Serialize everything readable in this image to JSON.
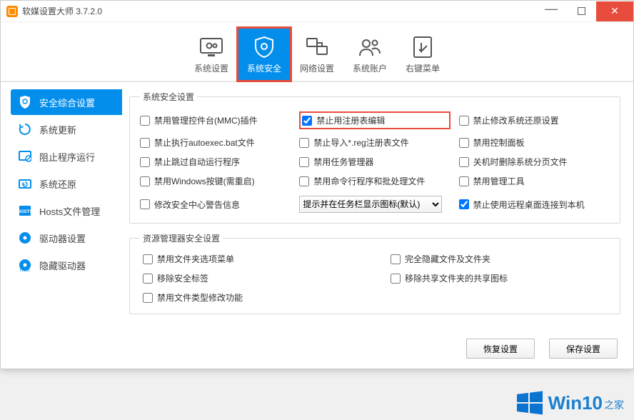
{
  "title": "软媒设置大师 3.7.2.0",
  "tabs": [
    {
      "label": "系统设置"
    },
    {
      "label": "系统安全"
    },
    {
      "label": "网络设置"
    },
    {
      "label": "系统账户"
    },
    {
      "label": "右键菜单"
    }
  ],
  "sidebar": [
    {
      "label": "安全综合设置"
    },
    {
      "label": "系统更新"
    },
    {
      "label": "阻止程序运行"
    },
    {
      "label": "系统还原"
    },
    {
      "label": "Hosts文件管理"
    },
    {
      "label": "驱动器设置"
    },
    {
      "label": "隐藏驱动器"
    }
  ],
  "group1": {
    "title": "系统安全设置",
    "items": [
      "禁用管理控件台(MMC)插件",
      "禁止用注册表编辑",
      "禁止修改系统还原设置",
      "禁止执行autoexec.bat文件",
      "禁止导入*.reg注册表文件",
      "禁用控制面板",
      "禁止跳过自动运行程序",
      "禁用任务管理器",
      "关机时删除系统分页文件",
      "禁用Windows按键(需重启)",
      "禁用命令行程序和批处理文件",
      "禁用管理工具"
    ],
    "bottom_left": "修改安全中心警告信息",
    "bottom_right": "禁止使用远程桌面连接到本机",
    "select": {
      "value": "提示并在任务栏显示图标(默认)"
    }
  },
  "group2": {
    "title": "资源管理器安全设置",
    "items": [
      "禁用文件夹选项菜单",
      "完全隐藏文件及文件夹",
      "移除安全标签",
      "移除共享文件夹的共享图标",
      "禁用文件类型修改功能"
    ]
  },
  "buttons": {
    "restore": "恢复设置",
    "save": "保存设置"
  },
  "watermark": {
    "brand": "Win10",
    "suffix": "之家"
  }
}
